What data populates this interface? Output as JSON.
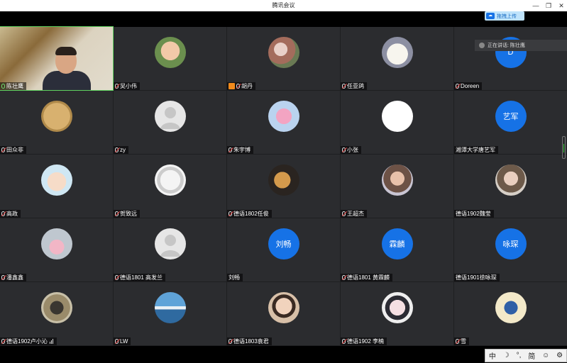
{
  "window": {
    "title": "腾讯会议",
    "minimize": "—",
    "restore": "❐",
    "close": "✕"
  },
  "upload": {
    "label": "拖拽上传"
  },
  "speaking": {
    "label": "正在讲话: 陈壮鹰"
  },
  "participants": [
    {
      "name": "陈壮鹰",
      "avatar": "video",
      "mic": "on"
    },
    {
      "name": "吴小伟",
      "avatar": "photo-baby",
      "mic": "off"
    },
    {
      "name": "胡丹",
      "avatar": "photo-flowers",
      "mic": "off",
      "host": true
    },
    {
      "name": "任亚鸽",
      "avatar": "photo-bear",
      "mic": "off"
    },
    {
      "name": "Doreen",
      "avatar": "text",
      "avatar_text": "D",
      "mic": "off"
    },
    {
      "name": "田众非",
      "avatar": "photo-emblem",
      "mic": "off"
    },
    {
      "name": "zy",
      "avatar": "default",
      "mic": "off"
    },
    {
      "name": "朱宇博",
      "avatar": "photo-pig",
      "mic": "off"
    },
    {
      "name": "小张",
      "avatar": "photo-sketch",
      "mic": "off"
    },
    {
      "name": "湘潭大学唐艺军",
      "avatar": "text",
      "avatar_text": "艺军",
      "mic": "none"
    },
    {
      "name": "高政",
      "avatar": "photo-cartoon",
      "mic": "off"
    },
    {
      "name": "贺致远",
      "avatar": "photo-manga",
      "mic": "off"
    },
    {
      "name": "德语1802任俊",
      "avatar": "photo-dark",
      "mic": "off"
    },
    {
      "name": "王超杰",
      "avatar": "photo-girl",
      "mic": "off"
    },
    {
      "name": "德语1902魏莹",
      "avatar": "photo-portrait",
      "mic": "none"
    },
    {
      "name": "潘鑫鑫",
      "avatar": "photo-pink",
      "mic": "off"
    },
    {
      "name": "德语1801 高发兰",
      "avatar": "default",
      "mic": "off"
    },
    {
      "name": "刘畅",
      "avatar": "text",
      "avatar_text": "刘畅",
      "mic": "none"
    },
    {
      "name": "德语1801 黄霖麟",
      "avatar": "text",
      "avatar_text": "霖麟",
      "mic": "off"
    },
    {
      "name": "德语1901徐咏琛",
      "avatar": "text",
      "avatar_text": "咏琛",
      "mic": "none"
    },
    {
      "name": "德语1902卢小沁",
      "avatar": "photo-person",
      "mic": "off",
      "signal": true
    },
    {
      "name": "LW",
      "avatar": "photo-sky",
      "mic": "off"
    },
    {
      "name": "德语1803袁君",
      "avatar": "photo-child",
      "mic": "off"
    },
    {
      "name": "德语1902 李楠",
      "avatar": "photo-anime",
      "mic": "off"
    },
    {
      "name": "雪",
      "avatar": "photo-illustration",
      "mic": "off"
    }
  ],
  "ime": {
    "lang": "中",
    "moon": "☽",
    "punct": "°,",
    "simp": "简",
    "emoji": "☺",
    "settings": "⚙"
  },
  "colors": {
    "accent": "#1672e6",
    "tile_bg": "#2b2c2f",
    "host": "#f08a1c"
  }
}
